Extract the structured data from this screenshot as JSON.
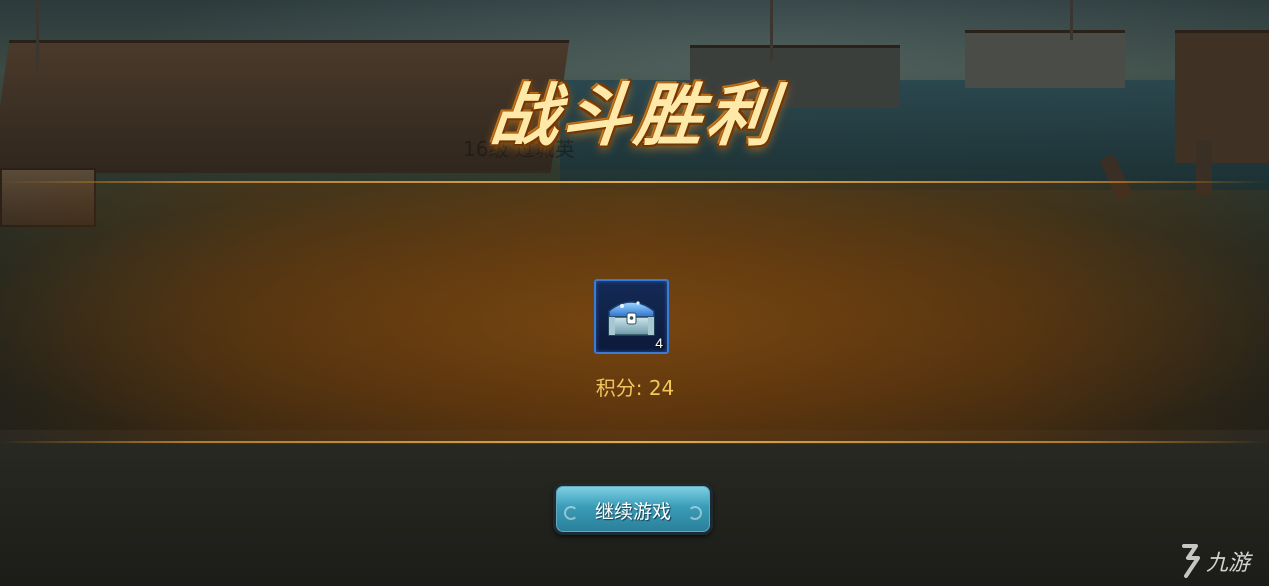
{
  "screen": {
    "title": "战斗胜利",
    "ghost_text": "16级 过城英"
  },
  "reward": {
    "item_icon": "treasure-chest-icon",
    "item_count": "4",
    "score_text": "积分: 24"
  },
  "actions": {
    "continue_label": "继续游戏"
  },
  "watermark": {
    "text": "九游"
  },
  "colors": {
    "panel_accent": "#e2a94d",
    "score": "#f2c65c",
    "button": "#3a9cb8",
    "item_border": "#3a7bd5"
  }
}
